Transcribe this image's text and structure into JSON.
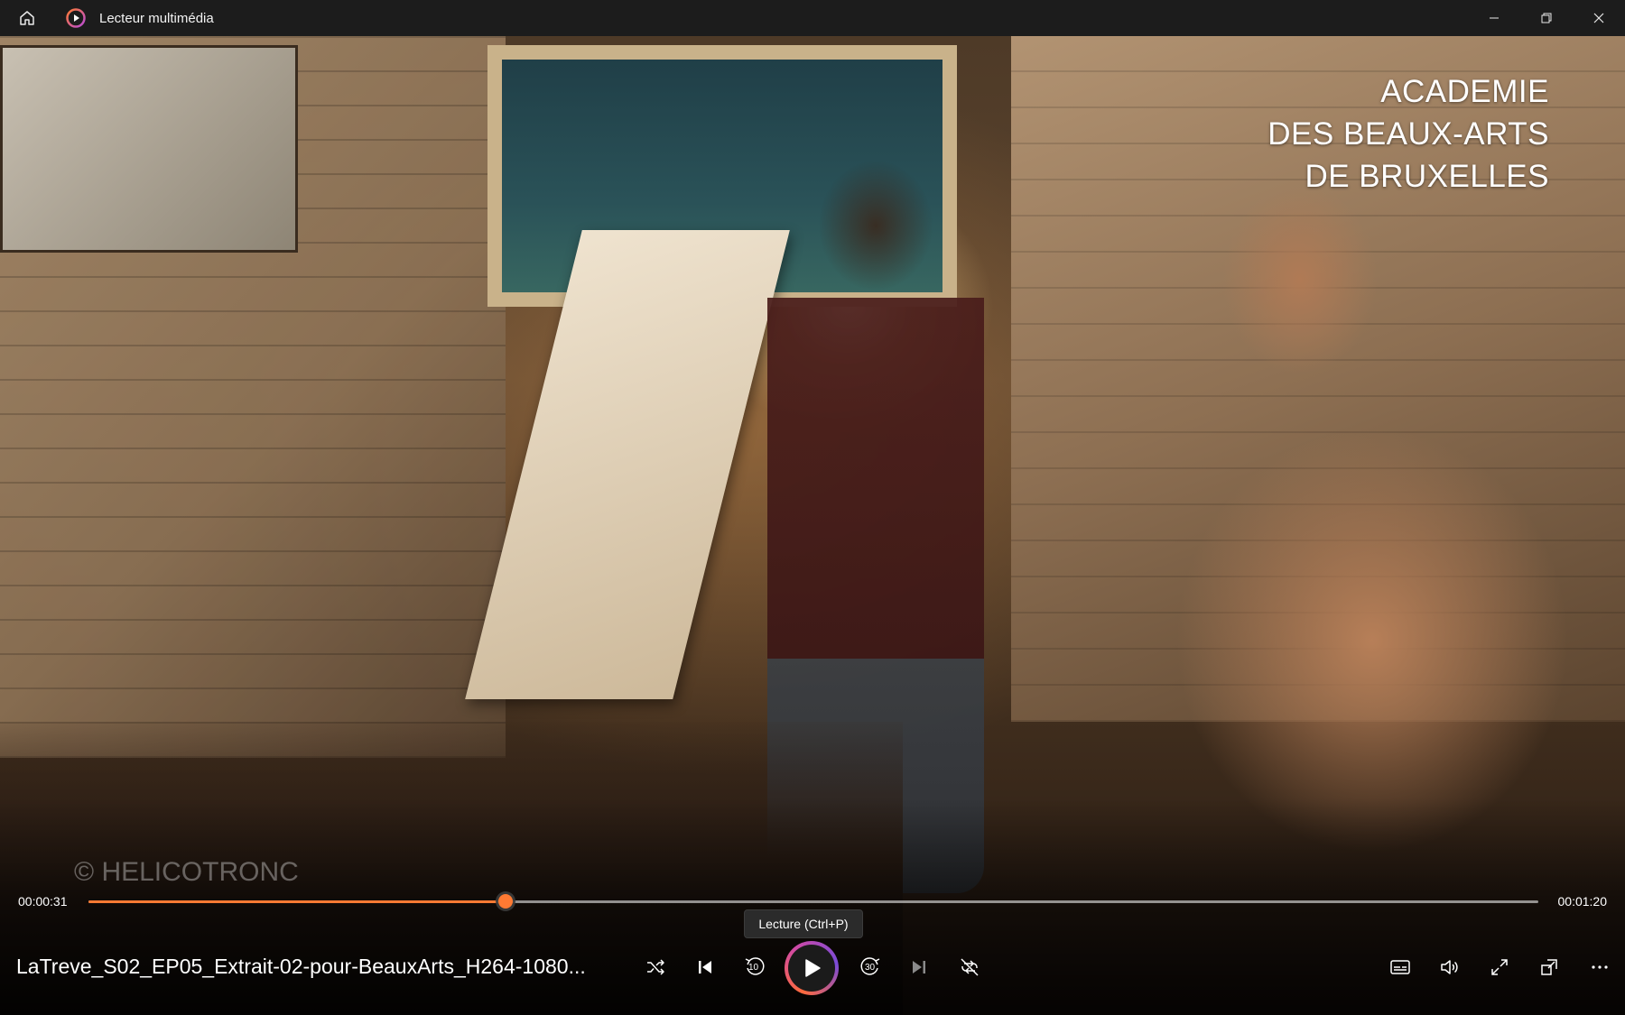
{
  "window": {
    "title": "Lecteur multimédia",
    "controls": [
      "minimize-icon",
      "restore-icon",
      "close-icon"
    ]
  },
  "video": {
    "overlay_lines": [
      "ACADEMIE",
      "DES BEAUX-ARTS",
      "DE BRUXELLES"
    ],
    "watermark": "© HELICOTRONC"
  },
  "player": {
    "elapsed": "00:00:31",
    "total": "00:01:20",
    "progress_fraction": 0.2875,
    "accent_color": "#ff7a33",
    "tooltip": "Lecture (Ctrl+P)",
    "file_title": "LaTreve_S02_EP05_Extrait-02-pour-BeauxArts_H264-1080...",
    "skip_back_seconds": "10",
    "skip_forward_seconds": "30",
    "left_controls": [
      "shuffle-icon",
      "previous-icon",
      "skip-back-10-icon",
      "play-icon",
      "skip-forward-30-icon",
      "next-icon",
      "repeat-off-icon"
    ],
    "right_controls": [
      "subtitles-icon",
      "volume-icon",
      "fullscreen-icon",
      "mini-player-icon",
      "more-icon"
    ]
  }
}
